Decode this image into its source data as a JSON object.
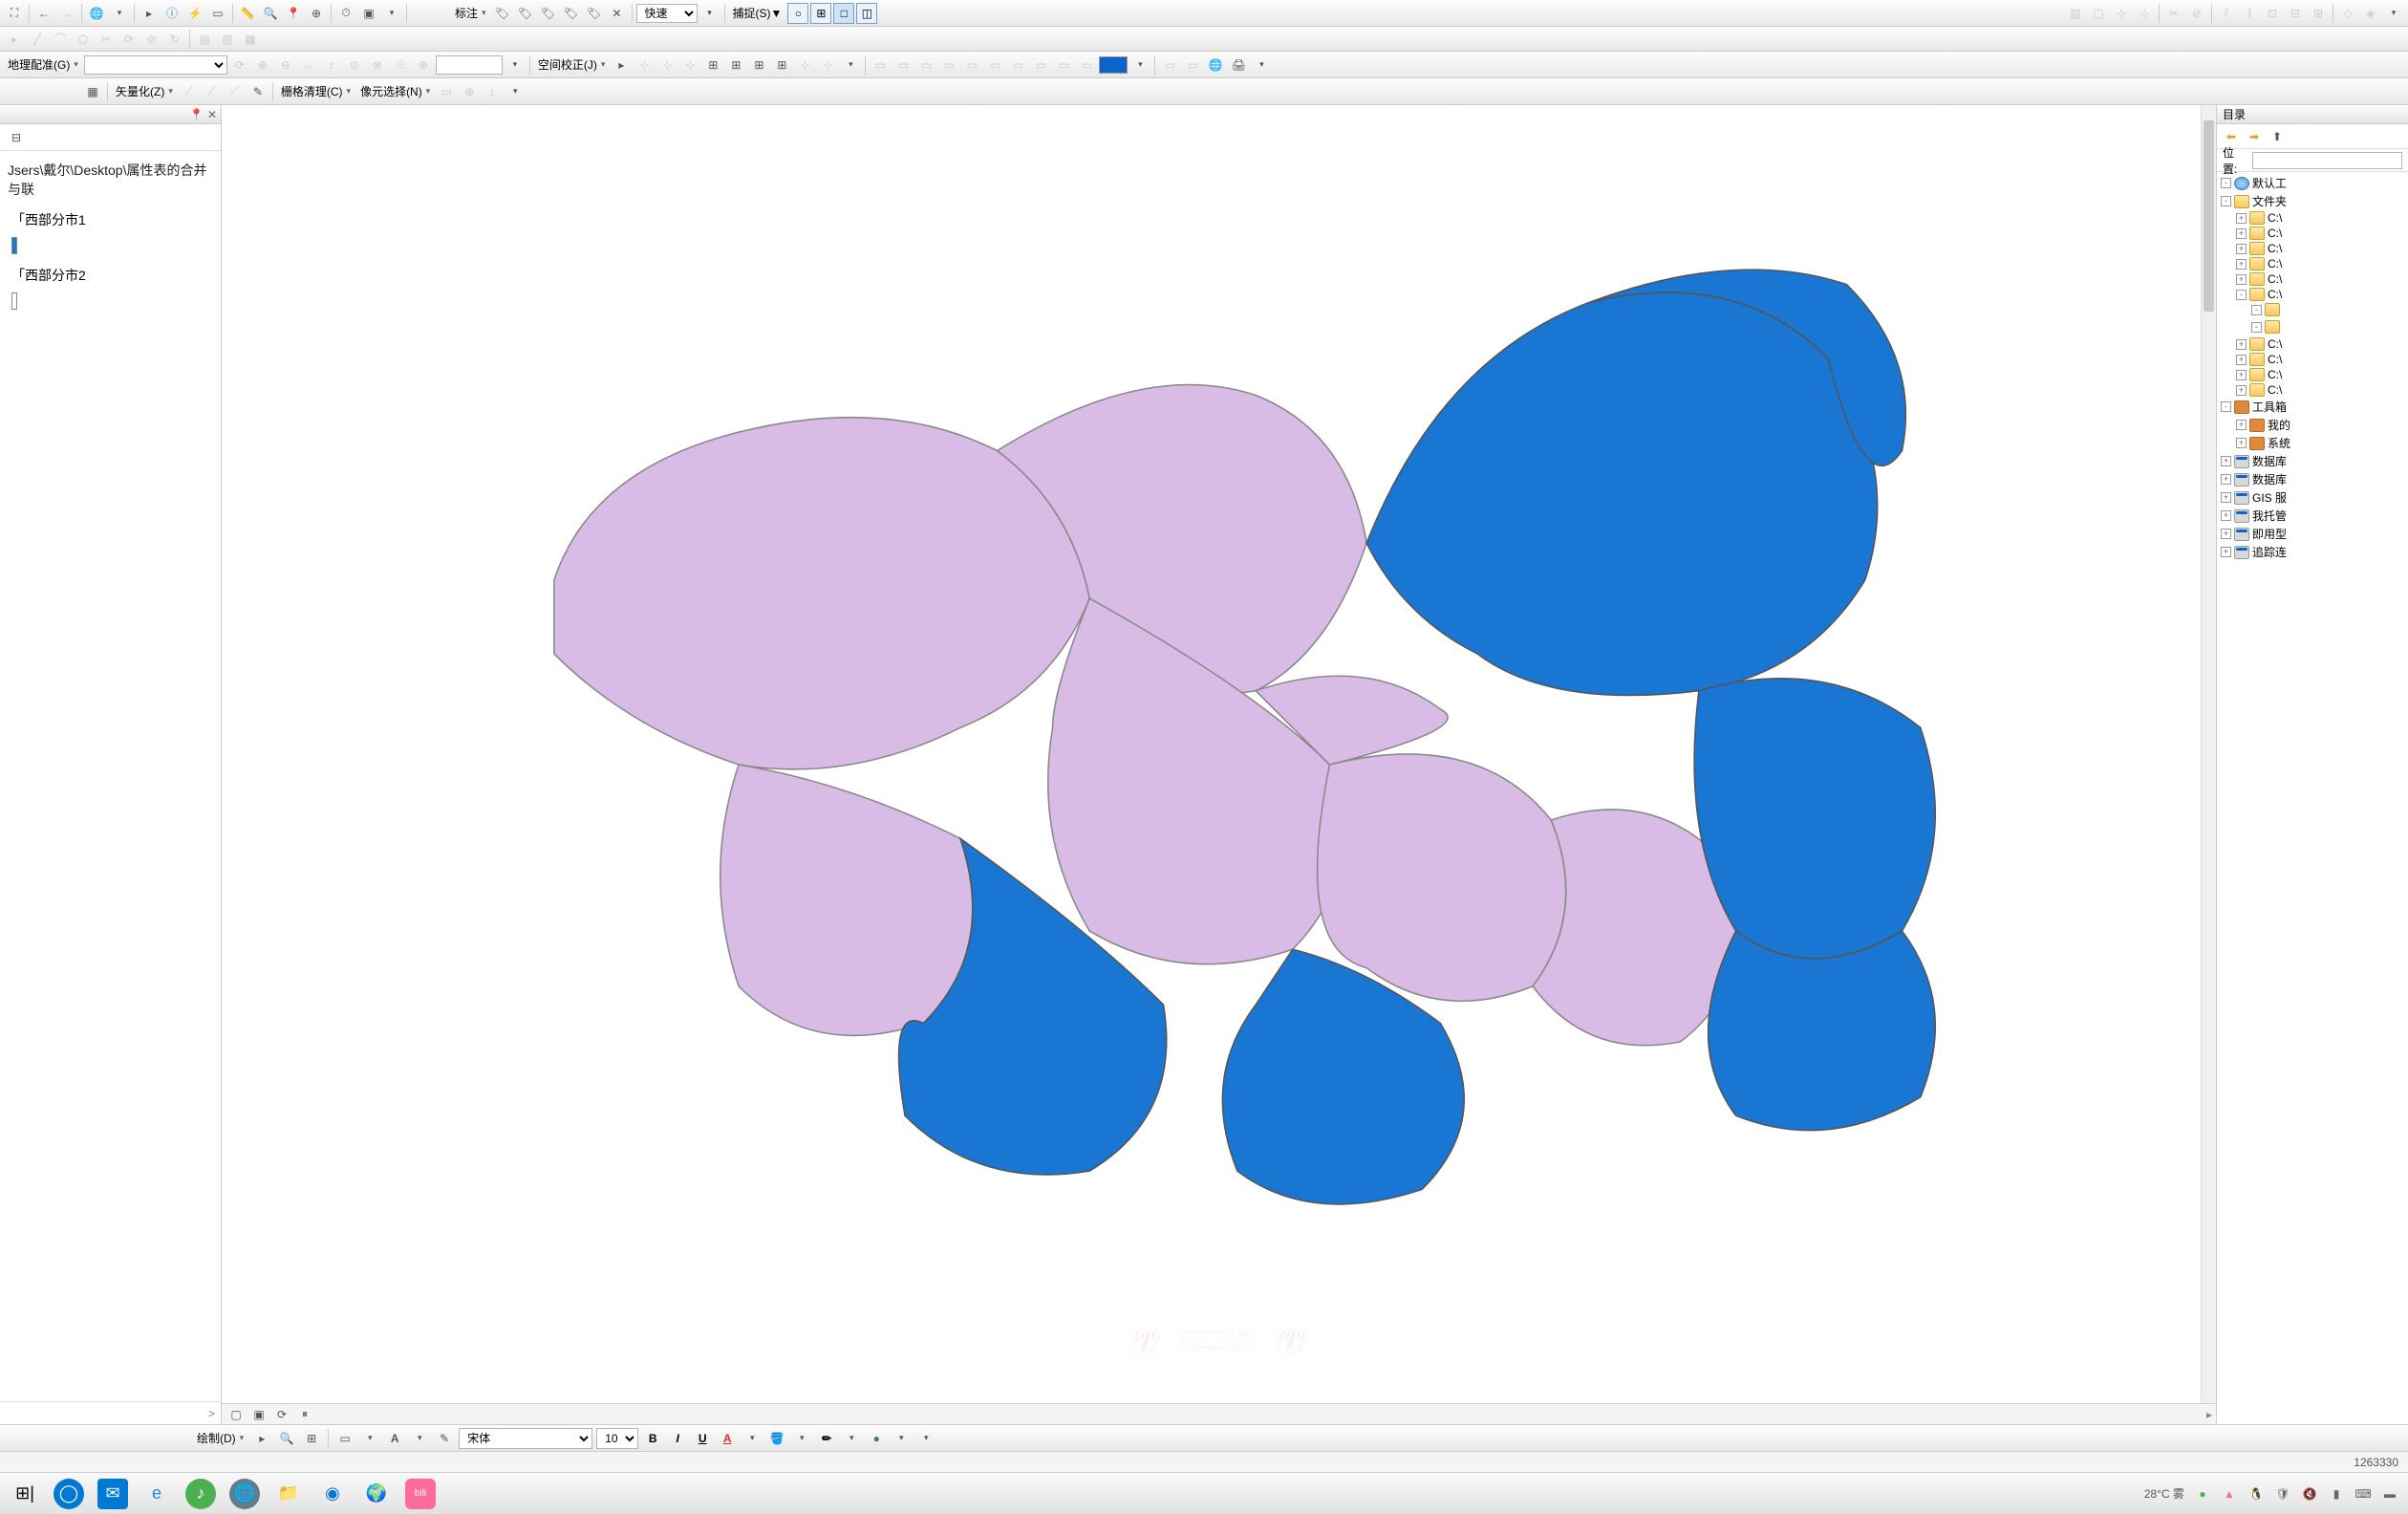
{
  "toolbar1": {
    "labeling_label": "标注",
    "quick_label": "快速",
    "snap_label": "捕捉(S)▼"
  },
  "toolbar2": {
    "georef_label": "地理配准(G)",
    "spatial_adj_label": "空间校正(J)"
  },
  "toolbar3": {
    "vectorize_label": "矢量化(Z)",
    "raster_clean_label": "栅格清理(C)",
    "pixel_select_label": "像元选择(N)"
  },
  "left": {
    "pin": "📌",
    "close": "✕",
    "path": "Jsers\\戴尔\\Desktop\\属性表的合并与联",
    "layer1": "「西部分市1",
    "layer2": "「西部分市2",
    "swatch1_color": "#1976d2",
    "scroll_hint": ">"
  },
  "right": {
    "title": "目录",
    "loc_label": "位置:",
    "nodes": [
      {
        "indent": 0,
        "exp": "-",
        "icon": "globe",
        "label": "默认工"
      },
      {
        "indent": 0,
        "exp": "-",
        "icon": "folder-open",
        "label": "文件夹"
      },
      {
        "indent": 1,
        "exp": "+",
        "icon": "folder-closed",
        "label": "C:\\"
      },
      {
        "indent": 1,
        "exp": "+",
        "icon": "folder-closed",
        "label": "C:\\"
      },
      {
        "indent": 1,
        "exp": "+",
        "icon": "folder-closed",
        "label": "C:\\"
      },
      {
        "indent": 1,
        "exp": "+",
        "icon": "folder-closed",
        "label": "C:\\"
      },
      {
        "indent": 1,
        "exp": "+",
        "icon": "folder-closed",
        "label": "C:\\"
      },
      {
        "indent": 1,
        "exp": "-",
        "icon": "folder-open",
        "label": "C:\\"
      },
      {
        "indent": 2,
        "exp": "-",
        "icon": "folder-open",
        "label": ""
      },
      {
        "indent": 3,
        "exp": "",
        "icon": "",
        "label": ""
      },
      {
        "indent": 2,
        "exp": "-",
        "icon": "folder-open",
        "label": ""
      },
      {
        "indent": 3,
        "exp": "",
        "icon": "",
        "label": ""
      },
      {
        "indent": 1,
        "exp": "+",
        "icon": "folder-closed",
        "label": "C:\\"
      },
      {
        "indent": 1,
        "exp": "+",
        "icon": "folder-closed",
        "label": "C:\\"
      },
      {
        "indent": 1,
        "exp": "+",
        "icon": "folder-closed",
        "label": "C:\\"
      },
      {
        "indent": 1,
        "exp": "+",
        "icon": "folder-closed",
        "label": "C:\\"
      },
      {
        "indent": 0,
        "exp": "-",
        "icon": "toolbox",
        "label": "工具箱"
      },
      {
        "indent": 1,
        "exp": "+",
        "icon": "toolbox",
        "label": "我的"
      },
      {
        "indent": 1,
        "exp": "+",
        "icon": "toolbox",
        "label": "系统"
      },
      {
        "indent": 0,
        "exp": "+",
        "icon": "db",
        "label": "数据库"
      },
      {
        "indent": 0,
        "exp": "+",
        "icon": "db",
        "label": "数据库"
      },
      {
        "indent": 0,
        "exp": "+",
        "icon": "db",
        "label": "GIS 服"
      },
      {
        "indent": 0,
        "exp": "+",
        "icon": "db",
        "label": "我托管"
      },
      {
        "indent": 0,
        "exp": "+",
        "icon": "db",
        "label": "即用型"
      },
      {
        "indent": 0,
        "exp": "+",
        "icon": "db",
        "label": "追踪连"
      }
    ]
  },
  "subtitle": "属性表的合并",
  "format": {
    "draw_label": "绘制(D)",
    "font_name": "宋体",
    "font_size": "10"
  },
  "status": {
    "coords": "1263330"
  },
  "taskbar": {
    "weather": "28°C  雾"
  }
}
